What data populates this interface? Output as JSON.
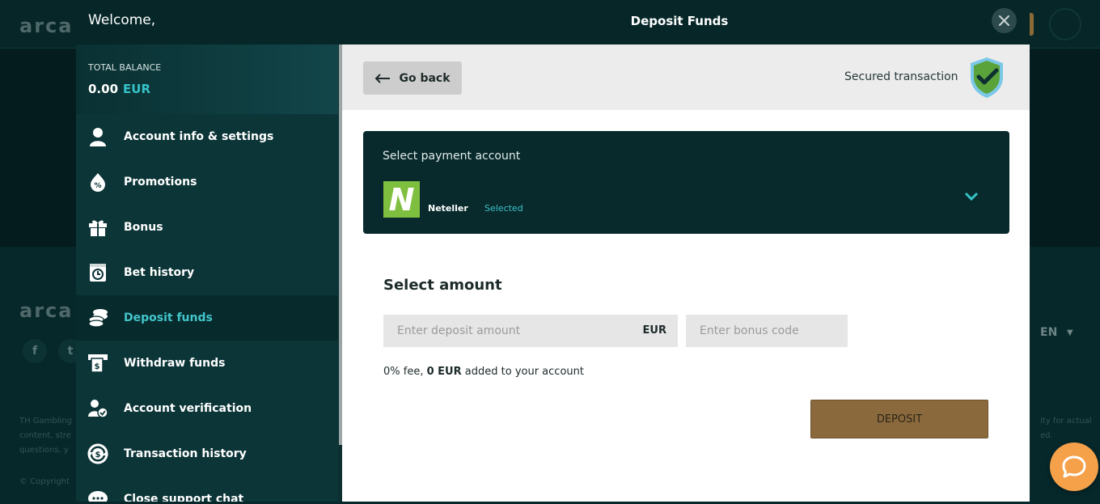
{
  "background": {
    "logo_text": "arca",
    "footer_text_left": [
      "TH Gambling",
      "content, stre",
      "questions, y"
    ],
    "footer_text_right": [
      "ity for actual",
      "ed."
    ],
    "copyright": "© Copyright",
    "language": "EN",
    "social": [
      "f",
      "t"
    ]
  },
  "header": {
    "welcome": "Welcome,",
    "title": "Deposit Funds"
  },
  "balance": {
    "label": "TOTAL BALANCE",
    "amount": "0.00",
    "currency": "EUR"
  },
  "sidebar": {
    "items": [
      {
        "label": "Account info & settings",
        "icon": "user-icon"
      },
      {
        "label": "Promotions",
        "icon": "promotion-icon"
      },
      {
        "label": "Bonus",
        "icon": "gift-icon"
      },
      {
        "label": "Bet history",
        "icon": "clock-icon"
      },
      {
        "label": "Deposit funds",
        "icon": "coins-icon",
        "active": true
      },
      {
        "label": "Withdraw funds",
        "icon": "atm-icon"
      },
      {
        "label": "Account verification",
        "icon": "user-check-icon"
      },
      {
        "label": "Transaction history",
        "icon": "transaction-icon"
      },
      {
        "label": "Close support chat",
        "icon": "chat-icon"
      }
    ]
  },
  "top_bar": {
    "go_back": "Go back",
    "secured": "Secured transaction"
  },
  "payment": {
    "title": "Select payment account",
    "logo_letter": "N",
    "name": "Neteller",
    "status": "Selected"
  },
  "amount": {
    "title": "Select amount",
    "placeholder": "Enter deposit amount",
    "currency": "EUR",
    "bonus_placeholder": "Enter bonus code",
    "fee_prefix": "0% fee,",
    "fee_amount": "0 EUR",
    "fee_suffix": "added to your account",
    "deposit_label": "DEPOSIT"
  },
  "colors": {
    "accent": "#35c3c7",
    "deposit_button": "#8a6a3d",
    "dark_teal": "#062628",
    "neteller_green": "#7fbf3f",
    "chat_button": "#f5a14a"
  }
}
